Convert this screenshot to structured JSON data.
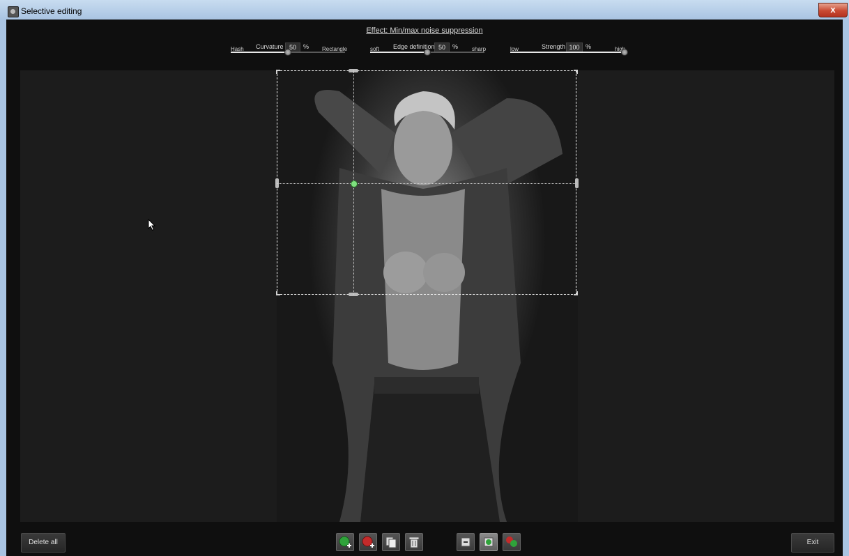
{
  "window": {
    "title": "Selective editing",
    "close_glyph": "x"
  },
  "effect": {
    "title": "Effect: Min/max noise suppression"
  },
  "sliders": [
    {
      "left_label": "Hash",
      "label": "Curvature",
      "value": "50",
      "unit": "%",
      "right_label": "Rectangle",
      "level": 0.5
    },
    {
      "left_label": "soft",
      "label": "Edge definition",
      "value": "50",
      "unit": "%",
      "right_label": "sharp",
      "level": 0.5
    },
    {
      "left_label": "low",
      "label": "Strength",
      "value": "100",
      "unit": "%",
      "right_label": "high",
      "level": 1.0
    }
  ],
  "buttons": {
    "delete_all": "Delete all",
    "exit": "Exit"
  },
  "toolbar": {
    "tools": [
      {
        "name": "add-green-selection-icon",
        "active": false
      },
      {
        "name": "add-red-selection-icon",
        "active": false
      },
      {
        "name": "copy-selection-icon",
        "active": false
      },
      {
        "name": "delete-selection-icon",
        "active": false
      },
      {
        "name": "view-minus-icon",
        "active": false
      },
      {
        "name": "view-green-icon",
        "active": true
      },
      {
        "name": "view-mixed-icon",
        "active": false
      }
    ]
  },
  "colors": {
    "selection_center": "#7ee07e",
    "background": "#0f0f0f",
    "canvas": "#1c1c1c"
  }
}
